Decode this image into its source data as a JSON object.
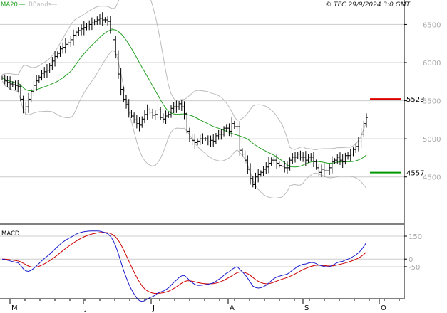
{
  "header": {
    "ma_label": "MA20",
    "bbands_label": "BBands",
    "copyright": "© TEC 29/9/2024 3:0 GMT"
  },
  "macd_label": "MACD",
  "colors": {
    "price_bar": "#000000",
    "ma20": "#22a022",
    "bbands": "#bbbbbb",
    "level_red": "#dd0000",
    "level_green": "#009900",
    "macd_line": "#1a1acc",
    "signal_line": "#cc0000",
    "grid": "#cccccc",
    "axis": "#000000"
  },
  "chart_data": [
    {
      "type": "ohlc",
      "title": "",
      "indicators": [
        "MA20",
        "BBands"
      ],
      "ylim": [
        3900,
        6700
      ],
      "y_ticks": [
        4500,
        5000,
        5500,
        6000,
        6500
      ],
      "grid": true,
      "x_months": [
        "M",
        "J",
        "J",
        "A",
        "S",
        "O"
      ],
      "levels": [
        {
          "name": "resistance",
          "value": 5523,
          "color": "#dd0000"
        },
        {
          "name": "support",
          "value": 4557,
          "color": "#009900"
        }
      ],
      "close": [
        5800,
        5760,
        5740,
        5720,
        5710,
        5700,
        5690,
        5520,
        5380,
        5420,
        5520,
        5620,
        5700,
        5760,
        5810,
        5860,
        5880,
        5900,
        5960,
        6020,
        6080,
        6120,
        6180,
        6200,
        6240,
        6260,
        6300,
        6360,
        6400,
        6420,
        6440,
        6460,
        6480,
        6500,
        6520,
        6540,
        6560,
        6580,
        6560,
        6560,
        6540,
        6450,
        6300,
        6100,
        5850,
        5650,
        5520,
        5450,
        5350,
        5300,
        5250,
        5200,
        5180,
        5260,
        5320,
        5380,
        5350,
        5310,
        5320,
        5380,
        5280,
        5260,
        5300,
        5320,
        5400,
        5420,
        5420,
        5460,
        5420,
        5330,
        5100,
        5000,
        4980,
        4950,
        4970,
        5000,
        5000,
        5000,
        4960,
        4980,
        4970,
        5040,
        5060,
        5060,
        5140,
        5140,
        5100,
        5200,
        5160,
        5160,
        4850,
        4800,
        4720,
        4600,
        4480,
        4400,
        4500,
        4530,
        4560,
        4600,
        4630,
        4680,
        4720,
        4720,
        4680,
        4650,
        4640,
        4620,
        4620,
        4720,
        4760,
        4760,
        4800,
        4760,
        4760,
        4720,
        4760,
        4760,
        4700,
        4620,
        4560,
        4600,
        4580,
        4580,
        4620,
        4700,
        4720,
        4760,
        4720,
        4700,
        4780,
        4780,
        4800,
        4860,
        4900,
        4960,
        5060,
        5200,
        5280
      ]
    },
    {
      "type": "line",
      "title": "MACD",
      "series": [
        {
          "name": "MACD",
          "role": "macd"
        },
        {
          "name": "",
          "role": "signal"
        }
      ],
      "ylim": [
        -260,
        220
      ],
      "y_ticks": [
        150,
        0,
        -50
      ],
      "y_tick_labels": [
        "150",
        "0",
        "-50"
      ]
    }
  ]
}
